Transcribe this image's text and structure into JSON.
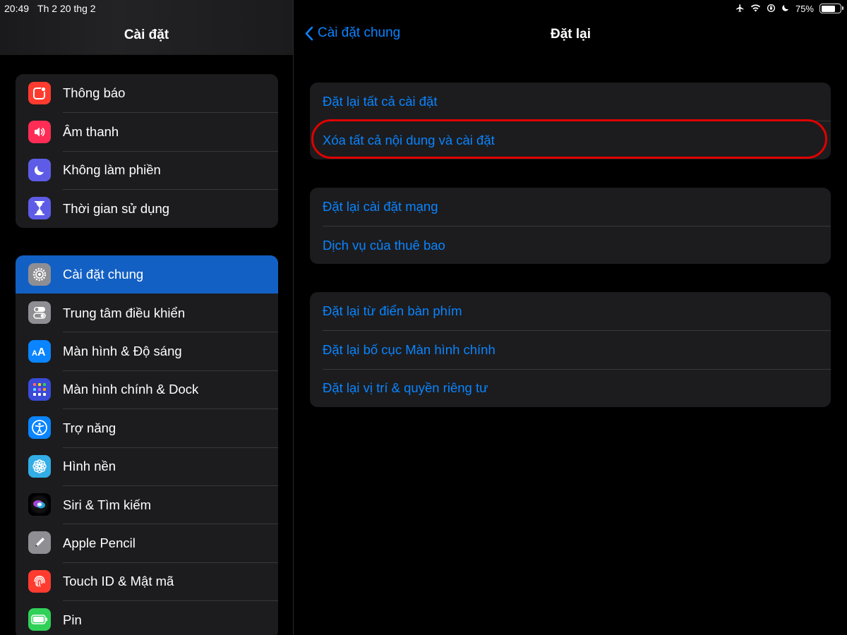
{
  "status": {
    "time": "20:49",
    "date": "Th 2 20 thg 2",
    "battery": "75%",
    "battery_level": 0.75,
    "icons": [
      "airplane-icon",
      "wifi-icon",
      "orientation-lock-icon",
      "moon-icon"
    ]
  },
  "sidebar": {
    "title": "Cài đặt",
    "group1": [
      {
        "label": "Thông báo",
        "icon": "notifications-icon",
        "color": "#ff3b30"
      },
      {
        "label": "Âm thanh",
        "icon": "sounds-icon",
        "color": "#ff2d55"
      },
      {
        "label": "Không làm phiền",
        "icon": "moon-icon",
        "color": "#5e5ce6"
      },
      {
        "label": "Thời gian sử dụng",
        "icon": "hourglass-icon",
        "color": "#5e5ce6"
      }
    ],
    "group2": [
      {
        "label": "Cài đặt chung",
        "icon": "gear-icon",
        "color": "#8e8e93",
        "selected": true
      },
      {
        "label": "Trung tâm điều khiển",
        "icon": "switches-icon",
        "color": "#8e8e93"
      },
      {
        "label": "Màn hình & Độ sáng",
        "icon": "text-size-icon",
        "color": "#0a84ff"
      },
      {
        "label": "Màn hình chính & Dock",
        "icon": "home-grid-icon",
        "color": "#3a4bd8"
      },
      {
        "label": "Trợ năng",
        "icon": "accessibility-icon",
        "color": "#0a84ff"
      },
      {
        "label": "Hình nền",
        "icon": "wallpaper-flower-icon",
        "color": "#32ade6"
      },
      {
        "label": "Siri & Tìm kiếm",
        "icon": "siri-icon",
        "color": "#1c1c1e"
      },
      {
        "label": "Apple Pencil",
        "icon": "pencil-icon",
        "color": "#8e8e93"
      },
      {
        "label": "Touch ID & Mật mã",
        "icon": "fingerprint-icon",
        "color": "#ff3b30"
      },
      {
        "label": "Pin",
        "icon": "battery-icon",
        "color": "#30d158"
      }
    ]
  },
  "main": {
    "back_label": "Cài đặt chung",
    "title": "Đặt lại",
    "groups": [
      [
        "Đặt lại tất cả cài đặt",
        "Xóa tất cả nội dung và cài đặt"
      ],
      [
        "Đặt lại cài đặt mạng",
        "Dịch vụ của thuê bao"
      ],
      [
        "Đặt lại từ điển bàn phím",
        "Đặt lại bố cục Màn hình chính",
        "Đặt lại vị trí & quyền riêng tư"
      ]
    ]
  }
}
